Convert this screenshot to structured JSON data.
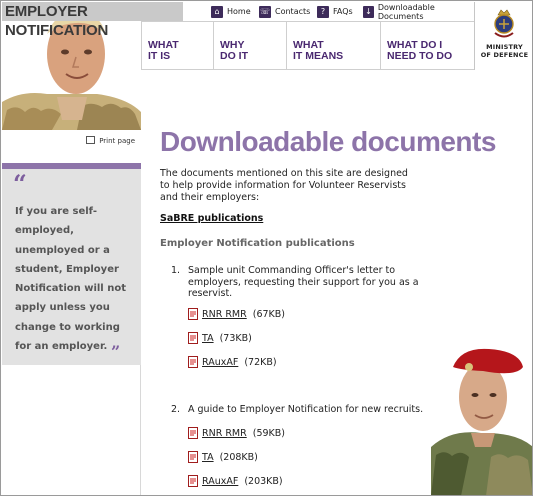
{
  "site": {
    "title": "EMPLOYER NOTIFICATION"
  },
  "utility_nav": [
    {
      "label": "Home",
      "icon": "home-icon"
    },
    {
      "label": "Contacts",
      "icon": "contacts-icon"
    },
    {
      "label": "FAQs",
      "icon": "faq-icon"
    },
    {
      "label": "Downloadable Documents",
      "icon": "download-icon"
    }
  ],
  "ministry": {
    "line1": "MINISTRY",
    "line2": "OF DEFENCE"
  },
  "main_nav": [
    {
      "line1": "WHAT",
      "line2": "IT IS"
    },
    {
      "line1": "WHY",
      "line2": "DO IT"
    },
    {
      "line1": "WHAT",
      "line2": "IT MEANS"
    },
    {
      "line1": "WHAT DO I",
      "line2": "NEED TO DO"
    }
  ],
  "sidebar": {
    "print_label": "Print page",
    "quote_open": "“",
    "quote_close": "”",
    "quote_text": "If you are self-employed, unemployed or a student, Employer Notification will not apply unless you change to working for an employer."
  },
  "main": {
    "heading": "Downloadable documents",
    "intro": "The documents mentioned on this site are designed to help provide information for Volunteer Reservists and their employers:",
    "sabre_link": "SaBRE publications",
    "section_heading": "Employer Notification publications",
    "items": [
      {
        "number": "1.",
        "text": "Sample unit Commanding Officer's letter to employers, requesting their support for you as a reservist.",
        "docs": [
          {
            "label": "RNR RMR",
            "size": "(67KB)"
          },
          {
            "label": "TA",
            "size": "(73KB)"
          },
          {
            "label": "RAuxAF",
            "size": "(72KB)"
          }
        ]
      },
      {
        "number": "2.",
        "text": "A guide to Employer Notification for new recruits.",
        "docs": [
          {
            "label": "RNR RMR",
            "size": "(59KB)"
          },
          {
            "label": "TA",
            "size": "(208KB)"
          },
          {
            "label": "RAuxAF",
            "size": "(203KB)"
          }
        ]
      }
    ]
  },
  "colors": {
    "accent_purple": "#8d74a9",
    "nav_purple": "#4a2870",
    "sidebar_grey": "#e2e2e2"
  }
}
